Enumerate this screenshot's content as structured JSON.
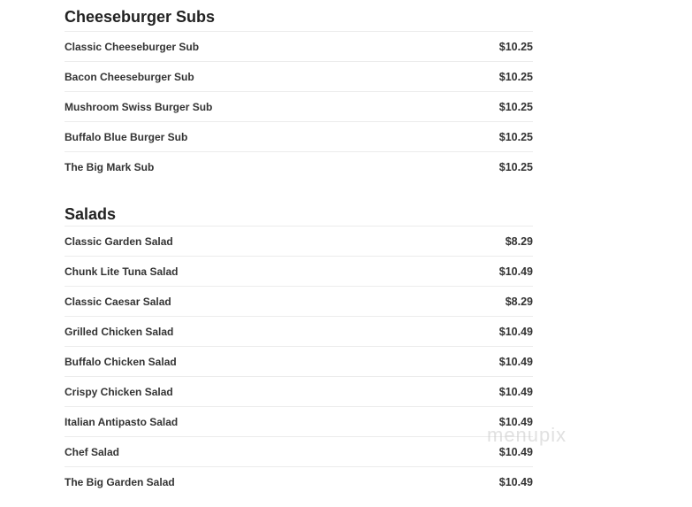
{
  "sections": [
    {
      "title": "Cheeseburger Subs",
      "items": [
        {
          "name": "Classic Cheeseburger Sub",
          "price": "$10.25"
        },
        {
          "name": "Bacon Cheeseburger Sub",
          "price": "$10.25"
        },
        {
          "name": "Mushroom Swiss Burger Sub",
          "price": "$10.25"
        },
        {
          "name": "Buffalo Blue Burger Sub",
          "price": "$10.25"
        },
        {
          "name": "The Big Mark Sub",
          "price": "$10.25"
        }
      ]
    },
    {
      "title": "Salads",
      "items": [
        {
          "name": "Classic Garden Salad",
          "price": "$8.29"
        },
        {
          "name": "Chunk Lite Tuna Salad",
          "price": "$10.49"
        },
        {
          "name": "Classic Caesar Salad",
          "price": "$8.29"
        },
        {
          "name": "Grilled Chicken Salad",
          "price": "$10.49"
        },
        {
          "name": "Buffalo Chicken Salad",
          "price": "$10.49"
        },
        {
          "name": "Crispy Chicken Salad",
          "price": "$10.49"
        },
        {
          "name": "Italian Antipasto Salad",
          "price": "$10.49"
        },
        {
          "name": "Chef Salad",
          "price": "$10.49"
        },
        {
          "name": "The Big Garden Salad",
          "price": "$10.49"
        }
      ]
    }
  ],
  "watermark": "menupix"
}
